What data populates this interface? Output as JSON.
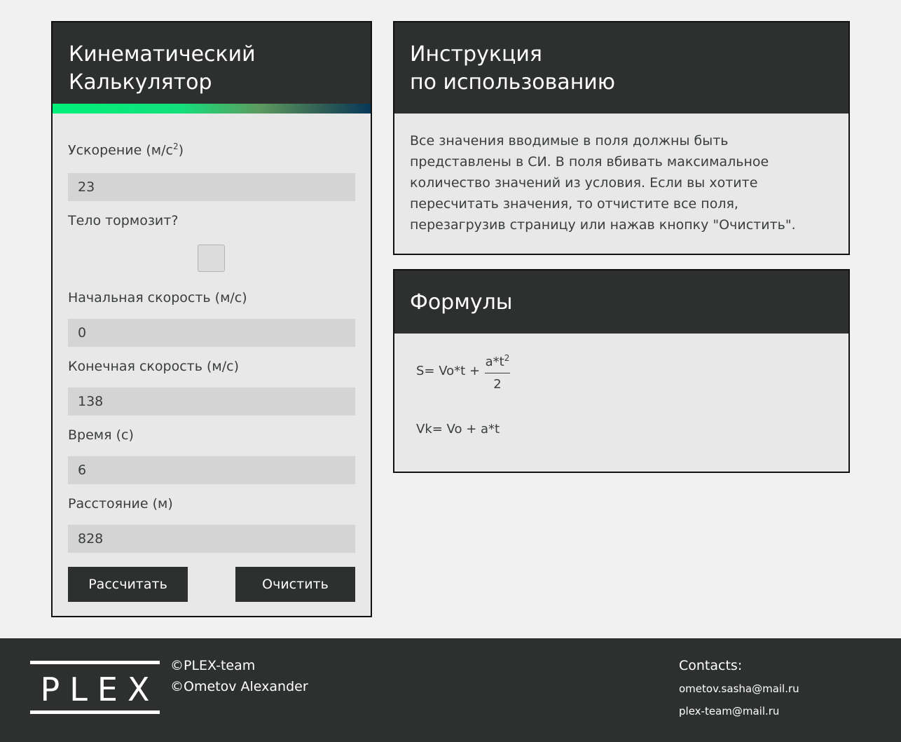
{
  "calculator": {
    "title_line1": "Кинематический",
    "title_line2": "Калькулятор",
    "acceleration_label": "Ускорение (м/с",
    "acceleration_sup": "2",
    "acceleration_label_end": ")",
    "acceleration_value": "23",
    "braking_label": "Тело тормозит?",
    "braking_checked": false,
    "initial_speed_label": "Начальная скорость (м/с)",
    "initial_speed_value": "0",
    "final_speed_label": "Конечная скорость (м/с)",
    "final_speed_value": "138",
    "time_label": "Время (с)",
    "time_value": "6",
    "distance_label": "Расстояние (м)",
    "distance_value": "828",
    "calculate_button": "Рассчитать",
    "clear_button": "Очистить"
  },
  "instructions": {
    "title_line1": "Инструкция",
    "title_line2": "по использованию",
    "text_line1": "Все значения вводимые в поля должны быть",
    "text_line2": "представлены в СИ. В поля вбивать максимальное",
    "text_line3": "количество значений из условия. Если вы хотите",
    "text_line4": "пересчитать значения, то отчистите все поля,",
    "text_line5": "перезагрузив страницу или нажав кнопку \"Очистить\"."
  },
  "formulas": {
    "title": "Формулы",
    "distance_lhs": "S= Vo*t +",
    "distance_numerator": "a*t",
    "distance_numerator_sup": "2",
    "distance_denominator": "2",
    "velocity": "Vk= Vo + a*t"
  },
  "footer": {
    "logo": "PLEX",
    "copyright_team": "©PLEX-team",
    "copyright_author": "©Ometov Alexander",
    "contacts_title": "Contacts:",
    "email_1": "ometov.sasha@mail.ru",
    "email_2": "plex-team@mail.ru"
  },
  "colors": {
    "dark": "#2e3030",
    "card_bg": "#e8e8e8",
    "input_bg": "#d4d4d4",
    "page_bg": "#f1f1f1"
  }
}
